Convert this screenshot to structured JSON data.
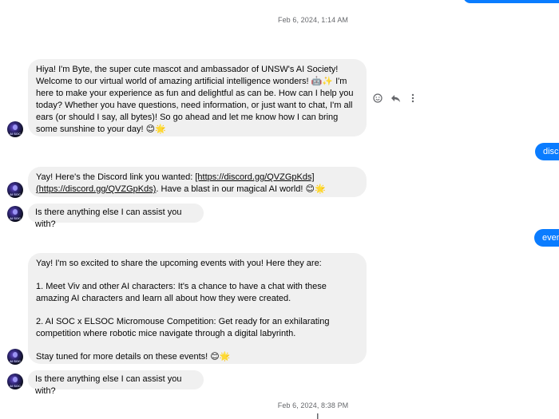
{
  "timestamps": {
    "first": "Feb 6, 2024, 1:14 AM",
    "second": "Feb 6, 2024, 8:38 PM"
  },
  "bot": {
    "avatar_label": "AI SOC",
    "messages": {
      "intro": "Hiya! I'm Byte, the super cute mascot and ambassador of UNSW's AI Society! Welcome to our virtual world of amazing artificial intelligence wonders! 🤖✨ I'm here to make your experience as fun and delightful as can be. How can I help you today? Whether you have questions, need information, or just want to chat, I'm all ears (or should I say, all bytes)! So go ahead and let me know how I can bring some sunshine to your day! 😊🌟",
      "discord": {
        "prefix": "Yay! Here's the Discord link you wanted: ",
        "link1": "[https://discord.gg/QVZGpKds]",
        "link2": "(https://discord.gg/QVZGpKds)",
        "suffix": ". Have a blast in our magical AI world! 😊🌟"
      },
      "assist1": "Is there anything else I can assist you with?",
      "events": {
        "intro": "Yay! I'm so excited to share the upcoming events with you! Here they are:",
        "item1": "1. Meet Viv and other AI characters: It's a chance to have a chat with these amazing AI characters and learn all about how they were created.",
        "item2": "2. AI SOC x ELSOC Micromouse Competition: Get ready for an exhilarating competition where robotic mice navigate through a digital labyrinth.",
        "outro": "Stay tuned for more details on these events! 😊🌟"
      },
      "assist2": "Is there anything else I can assist you with?"
    }
  },
  "user": {
    "messages": [
      "disco",
      "even"
    ]
  },
  "icons": {
    "react": "smiley-react-icon",
    "reply": "reply-arrow-icon",
    "more": "more-options-icon"
  },
  "colors": {
    "bubble_gray": "#f0f0f0",
    "bubble_blue": "#0a7cff",
    "timestamp": "#65676b"
  }
}
